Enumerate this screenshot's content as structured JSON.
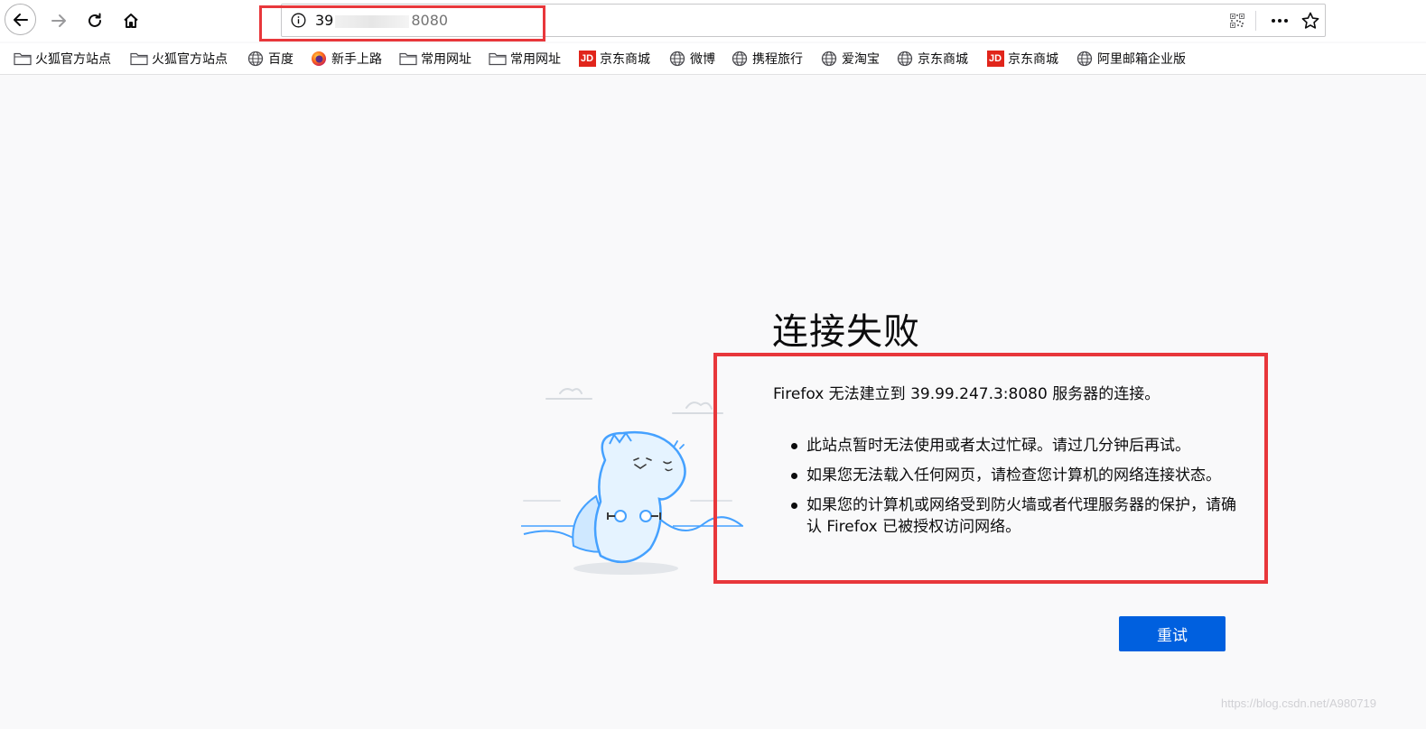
{
  "toolbar": {
    "url_prefix": "39",
    "url_suffix": "8080"
  },
  "bookmarks": [
    {
      "label": "火狐官方站点",
      "icon": "folder-icon"
    },
    {
      "label": "火狐官方站点",
      "icon": "folder-icon"
    },
    {
      "label": "百度",
      "icon": "globe-icon"
    },
    {
      "label": "新手上路",
      "icon": "firefox-icon"
    },
    {
      "label": "常用网址",
      "icon": "folder-icon"
    },
    {
      "label": "常用网址",
      "icon": "folder-icon"
    },
    {
      "label": "京东商城",
      "icon": "jd-icon",
      "badge": "JD"
    },
    {
      "label": "微博",
      "icon": "globe-icon"
    },
    {
      "label": "携程旅行",
      "icon": "globe-icon"
    },
    {
      "label": "爱淘宝",
      "icon": "globe-icon"
    },
    {
      "label": "京东商城",
      "icon": "globe-icon"
    },
    {
      "label": "京东商城",
      "icon": "jd-icon",
      "badge": "JD"
    },
    {
      "label": "阿里邮箱企业版",
      "icon": "globe-icon"
    }
  ],
  "error": {
    "title": "连接失败",
    "description": "Firefox 无法建立到 39.99.247.3:8080 服务器的连接。",
    "items": [
      "此站点暂时无法使用或者太过忙碌。请过几分钟后再试。",
      "如果您无法载入任何网页，请检查您计算机的网络连接状态。",
      "如果您的计算机或网络受到防火墙或者代理服务器的保护，请确认 Firefox 已被授权访问网络。"
    ],
    "retry_label": "重试"
  },
  "watermark": "https://blog.csdn.net/A980719",
  "colors": {
    "accent": "#0060df",
    "highlight_box": "#e8373b",
    "jd_red": "#e1251b"
  }
}
